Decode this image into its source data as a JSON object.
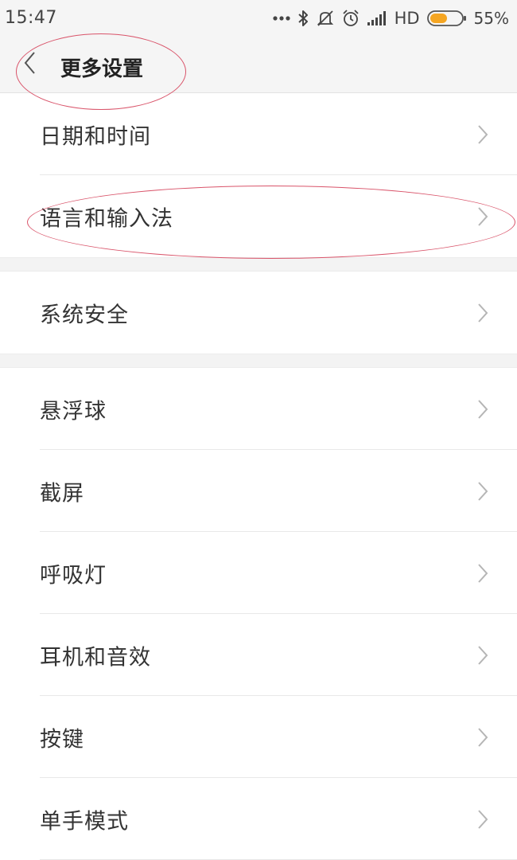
{
  "status_bar": {
    "time": "15:47",
    "network": "HD",
    "battery_percent": "55%",
    "battery_level": 0.55,
    "icons": [
      "more-dots-icon",
      "bluetooth-icon",
      "mute-icon",
      "alarm-icon",
      "signal-icon",
      "battery-icon"
    ]
  },
  "header": {
    "title": "更多设置",
    "back_icon": "chevron-left-icon"
  },
  "groups": [
    {
      "items": [
        {
          "label": "日期和时间"
        },
        {
          "label": "语言和输入法"
        }
      ]
    },
    {
      "items": [
        {
          "label": "系统安全"
        }
      ]
    },
    {
      "items": [
        {
          "label": "悬浮球"
        },
        {
          "label": "截屏"
        },
        {
          "label": "呼吸灯"
        },
        {
          "label": "耳机和音效"
        },
        {
          "label": "按键"
        },
        {
          "label": "单手模式"
        }
      ]
    }
  ],
  "colors": {
    "annotation": "#d9546a",
    "battery_fill": "#f5a623",
    "background": "#ffffff",
    "bar_background": "#f5f5f5"
  }
}
